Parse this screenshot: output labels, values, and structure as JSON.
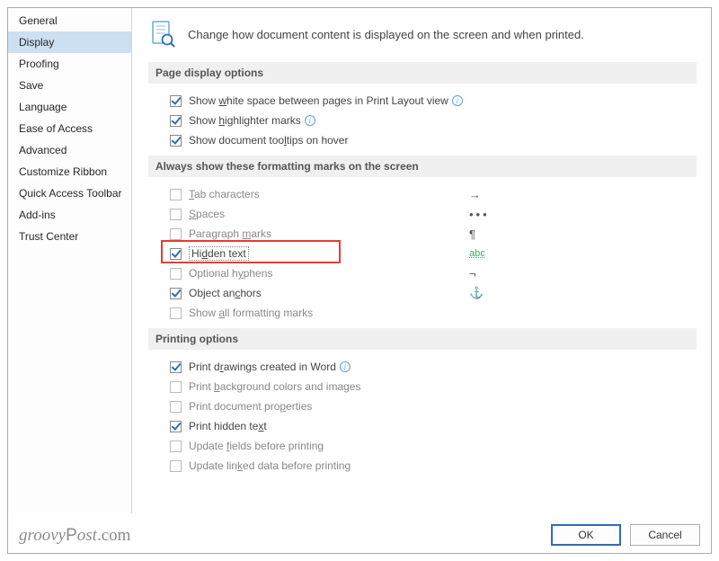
{
  "sidebar": {
    "items": [
      {
        "label": "General"
      },
      {
        "label": "Display"
      },
      {
        "label": "Proofing"
      },
      {
        "label": "Save"
      },
      {
        "label": "Language"
      },
      {
        "label": "Ease of Access"
      },
      {
        "label": "Advanced"
      },
      {
        "label": "Customize Ribbon"
      },
      {
        "label": "Quick Access Toolbar"
      },
      {
        "label": "Add-ins"
      },
      {
        "label": "Trust Center"
      }
    ],
    "selected_index": 1
  },
  "header": {
    "text": "Change how document content is displayed on the screen and when printed."
  },
  "sections": {
    "page_display": {
      "title": "Page display options",
      "whitespace": "Show white space between pages in Print Layout view",
      "highlighter": "Show highlighter marks",
      "tooltips": "Show document tooltips on hover"
    },
    "formatting_marks": {
      "title": "Always show these formatting marks on the screen",
      "tab": "Tab characters",
      "spaces": "Spaces",
      "paragraph": "Paragraph marks",
      "hidden": "Hidden text",
      "hyphens": "Optional hyphens",
      "anchors": "Object anchors",
      "all": "Show all formatting marks",
      "glyph_tab": "→",
      "glyph_spaces": "•••",
      "glyph_para": "¶",
      "glyph_hidden": "abc",
      "glyph_hyphen": "¬",
      "glyph_anchor": "⚓"
    },
    "printing": {
      "title": "Printing options",
      "drawings": "Print drawings created in Word",
      "background": "Print background colors and images",
      "properties": "Print document properties",
      "hidden": "Print hidden text",
      "update_fields": "Update fields before printing",
      "update_linked": "Update linked data before printing"
    }
  },
  "buttons": {
    "ok": "OK",
    "cancel": "Cancel"
  },
  "watermark": "groovyPost.com"
}
